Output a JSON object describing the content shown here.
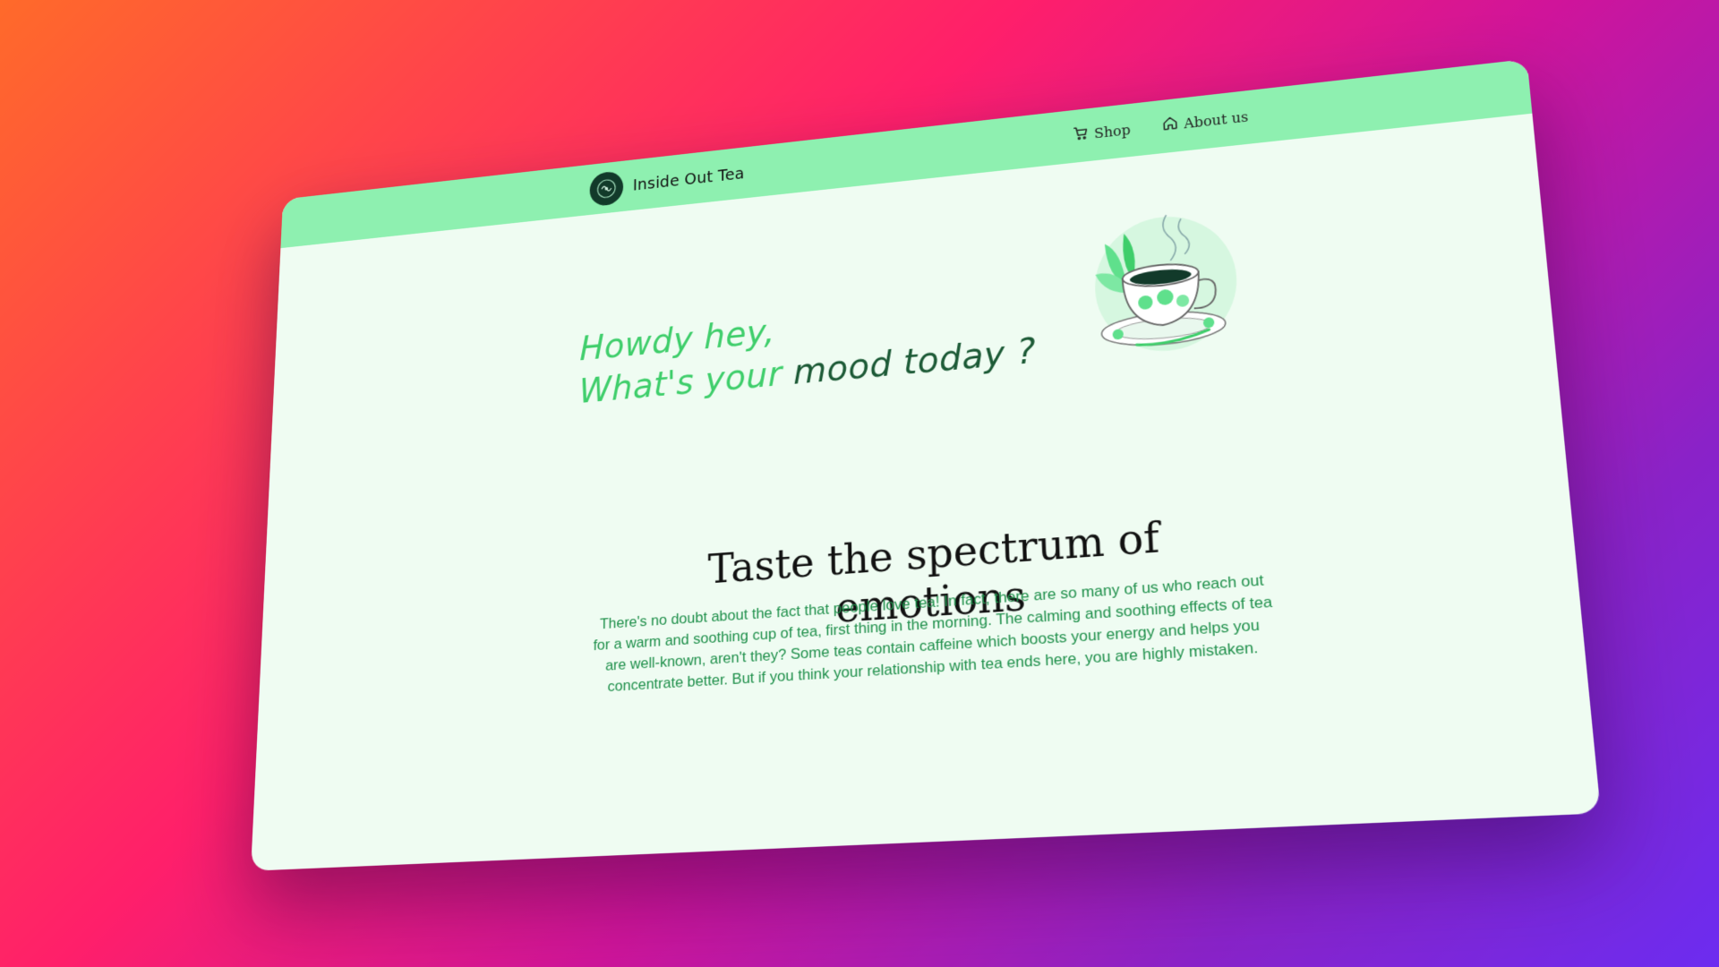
{
  "brand": {
    "name": "Inside Out Tea",
    "logo_icon": "tea-seal-logo-icon"
  },
  "nav": {
    "items": [
      {
        "label": "Shop",
        "icon": "cart-icon"
      },
      {
        "label": "About us",
        "icon": "home-icon"
      }
    ]
  },
  "hero": {
    "line1": "Howdy hey,",
    "line2_part1": "What's your",
    "line2_part2": "mood today ?",
    "illustration": "teacup-icon"
  },
  "section": {
    "title": "Taste the spectrum of emotions",
    "body": "There's no doubt about the fact that people love tea! In fact, there are so many of us who reach out for a warm and soothing cup of tea, first thing in the morning. The calming and soothing effects of tea are well-known, aren't they? Some teas contain caffeine which boosts your energy and helps you concentrate better. But if you think your relationship with tea ends here, you are highly mistaken."
  },
  "colors": {
    "navbar": "#8ef0b0",
    "page_bg": "#effcf2",
    "accent_green": "#3fce6b",
    "dark_green": "#1c5a36",
    "body_text": "#1e8f4a"
  }
}
